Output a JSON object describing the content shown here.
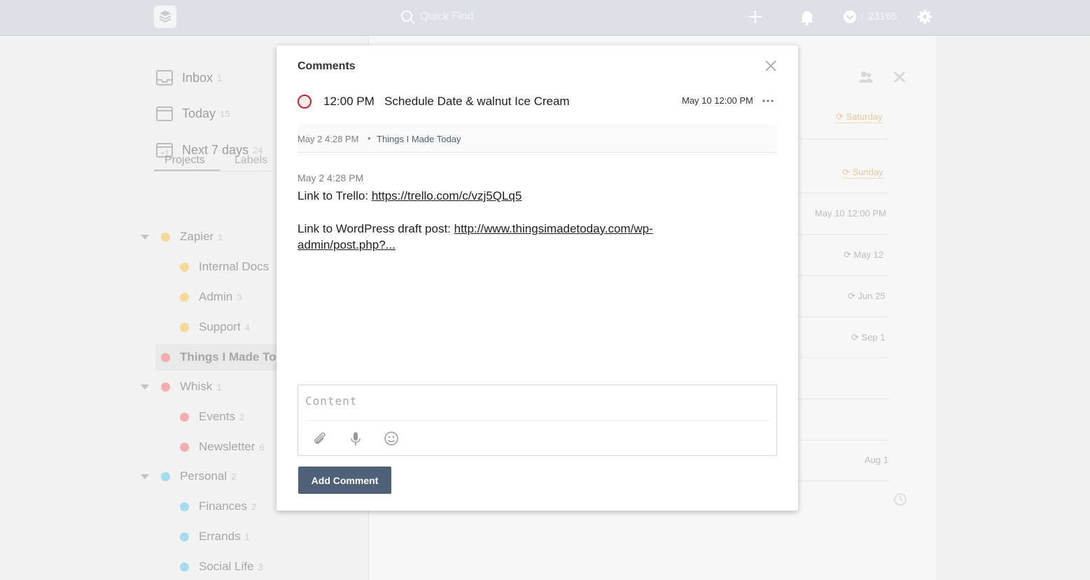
{
  "topbar": {
    "search_placeholder": "Quick Find",
    "karma": "23165",
    "icons": [
      "app-logo-icon",
      "search-icon",
      "plus-icon",
      "bell-icon",
      "karma-icon",
      "gear-icon"
    ]
  },
  "sidebar": {
    "nav": [
      {
        "label": "Inbox",
        "count": "1",
        "icon": "inbox-icon"
      },
      {
        "label": "Today",
        "count": "15",
        "icon": "calendar-icon"
      },
      {
        "label": "Next 7 days",
        "count": "24",
        "icon": "calendar-plus-icon"
      }
    ],
    "tabs": [
      "Projects",
      "Labels"
    ],
    "projects": [
      {
        "label": "Zapier",
        "count": "1",
        "color": "#f5d99a"
      },
      {
        "label": "Internal Docs",
        "count": "",
        "color": "#f5d99a"
      },
      {
        "label": "Admin",
        "count": "3",
        "color": "#f5d99a"
      },
      {
        "label": "Support",
        "count": "4",
        "color": "#f5d99a"
      },
      {
        "label": "Things I Made To",
        "count": "",
        "color": "#f2aeae"
      },
      {
        "label": "Whisk",
        "count": "1",
        "color": "#f2aeae"
      },
      {
        "label": "Events",
        "count": "2",
        "color": "#f2aeae"
      },
      {
        "label": "Newsletter",
        "count": "6",
        "color": "#f2aeae"
      },
      {
        "label": "Personal",
        "count": "2",
        "color": "#a7dcef"
      },
      {
        "label": "Finances",
        "count": "2",
        "color": "#a7dcef"
      },
      {
        "label": "Errands",
        "count": "1",
        "color": "#a7dcef"
      },
      {
        "label": "Social Life",
        "count": "3",
        "color": "#a7dcef"
      }
    ]
  },
  "background_dates": [
    "Saturday",
    "Sunday",
    "May 10 12:00 PM",
    "May 12",
    "Jun 25",
    "Sep 1",
    "Aug 1"
  ],
  "modal": {
    "title": "Comments",
    "task": {
      "time": "12:00 PM",
      "title": "Schedule Date & walnut Ice Cream",
      "due": "May 10 12:00 PM"
    },
    "meta": {
      "created": "May 2 4:28 PM",
      "separator": "•",
      "project": "Things I Made Today"
    },
    "comment": {
      "time": "May 2 4:28 PM",
      "line1_prefix": "Link to Trello: ",
      "line1_link": "https://trello.com/c/vzj5QLq5",
      "line2_prefix": "Link to WordPress draft post: ",
      "line2_link_a": "http://www.thingsimadetoday.com/wp-",
      "line2_link_b": "admin/post.php?..."
    },
    "composer": {
      "placeholder": "Content",
      "icons": [
        "paperclip-icon",
        "microphone-icon",
        "emoji-icon"
      ]
    },
    "submit_label": "Add Comment"
  },
  "colors": {
    "accent": "#4e6179",
    "priority_red": "#c0262f",
    "topbar": "#dde1e6"
  }
}
